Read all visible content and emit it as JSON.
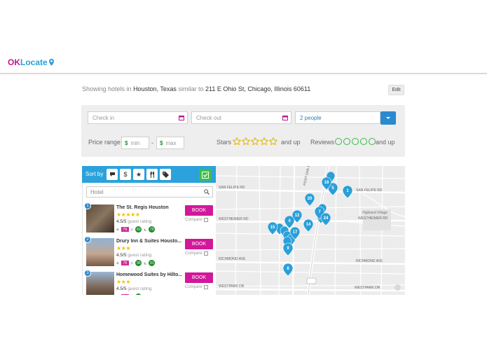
{
  "brand": {
    "name_part1": "OK",
    "name_part2": "Locate",
    "icon": "map-pin-icon",
    "color_primary": "#c2188f",
    "color_secondary": "#2a9fd8"
  },
  "summary": {
    "prefix": "Showing hotels in",
    "city": "Houston, Texas",
    "middle": "similar to",
    "address": "211 E Ohio St, Chicago, Illinois 60611",
    "edit_label": "Edit"
  },
  "search": {
    "check_in_placeholder": "Check in",
    "check_out_placeholder": "Check out",
    "guests_value": "2 people",
    "price_label": "Price range",
    "price_min_placeholder": "min",
    "price_max_placeholder": "max",
    "price_separator": "-",
    "currency_symbol": "$",
    "stars_label": "Stars",
    "stars_suffix": "and up",
    "reviews_label": "Reviews",
    "reviews_suffix": "and up"
  },
  "sort": {
    "label": "Sort by",
    "options": [
      "chat-icon",
      "dollar-icon",
      "star-icon",
      "fork-knife-icon",
      "tag-icon"
    ],
    "hotel_filter_placeholder": "Hotel"
  },
  "hotels": [
    {
      "rank": "1",
      "name": "The St. Regis Houston",
      "stars": "★★★★★",
      "rating_value": "4.5/5",
      "rating_label": "guest rating",
      "score_a": "79",
      "score_b": "83",
      "score_c": "79",
      "book_label": "BOOK",
      "compare_label": "Compare"
    },
    {
      "rank": "2",
      "name": "Drury Inn & Suites Housto...",
      "stars": "★★★",
      "rating_value": "4.5/5",
      "rating_label": "guest rating",
      "score_a": "79",
      "score_b": "95",
      "score_c": "91",
      "book_label": "BOOK",
      "compare_label": "Compare"
    },
    {
      "rank": "3",
      "name": "Homewood Suites by Hilto...",
      "stars": "★★★",
      "rating_value": "4.5/5",
      "rating_label": "guest rating",
      "score_a": "",
      "score_b": "",
      "score_c": "",
      "book_label": "BOOK",
      "compare_label": "Compare"
    }
  ],
  "map": {
    "streets": [
      "SAN FELIPE RD",
      "SAN FELIPE RD",
      "POST OAK BLVD",
      "WESTHEIMER RD",
      "WESTHEIMER RD",
      "RICHMOND AVE",
      "RICHMOND AVE",
      "WESTPARK DR",
      "WESTPARK DR",
      "Highland Village"
    ],
    "markers": [
      "1",
      "5",
      "18",
      "20",
      "12",
      "4",
      "7",
      "24",
      "15",
      "14",
      "9",
      "8",
      "17"
    ]
  },
  "colors": {
    "accent": "#2ba2dc",
    "book": "#d1179a",
    "stars": "#f2c200",
    "review_circle": "#3bb54a"
  }
}
